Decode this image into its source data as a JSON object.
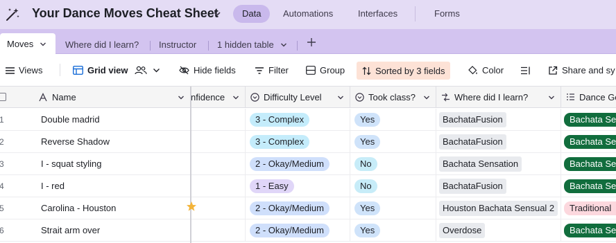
{
  "header": {
    "title": "Your Dance Moves Cheat Sheet",
    "nav": [
      "Data",
      "Automations",
      "Interfaces",
      "Forms"
    ]
  },
  "tables": {
    "active": "Moves",
    "others": [
      "Where did I learn?",
      "Instructor",
      "1 hidden table"
    ]
  },
  "toolbar": {
    "views": "Views",
    "grid_view": "Grid view",
    "hide_fields": "Hide fields",
    "filter": "Filter",
    "group": "Group",
    "sorted": "Sorted by 3 fields",
    "color": "Color",
    "share": "Share and sy"
  },
  "columns": [
    "Name",
    "nfidence",
    "Difficulty Level",
    "Took class?",
    "Where did I learn?",
    "Dance Ge"
  ],
  "rows": [
    {
      "num": "1",
      "name": "Double madrid",
      "difficulty": "3 - Complex",
      "took": "Yes",
      "where": "BachataFusion",
      "genre": "Bachata Se"
    },
    {
      "num": "2",
      "name": "Reverse Shadow",
      "difficulty": "3 - Complex",
      "took": "Yes",
      "where": "BachataFusion",
      "genre": "Bachata Se"
    },
    {
      "num": "3",
      "name": "I - squat styling",
      "difficulty": "2 - Okay/Medium",
      "took": "No",
      "where": "Bachata Sensation",
      "genre": "Bachata Se"
    },
    {
      "num": "4",
      "name": "I - red",
      "difficulty": "1 - Easy",
      "took": "No",
      "where": "BachataFusion",
      "genre": "Bachata Se"
    },
    {
      "num": "5",
      "name": "Carolina - Houston",
      "difficulty": "2 - Okay/Medium",
      "took": "Yes",
      "where": "Houston Bachata Sensual 2",
      "genre": "Traditional"
    },
    {
      "num": "6",
      "name": "Strait arm over",
      "difficulty": "2 - Okay/Medium",
      "took": "Yes",
      "where": "Overdose",
      "genre": "Bachata Se"
    }
  ],
  "colors": {
    "header_bg": "#e4dcf5",
    "tabs_bg": "#d3c4f0",
    "complex": "#c4ecfb",
    "medium": "#cfdffb",
    "easy": "#e0d6f8",
    "yes": "#cfe3fa",
    "no": "#c7ecf8",
    "location": "#e8eaee",
    "genre_bachata": "#116d3d",
    "genre_traditional": "#fcd8de",
    "sorted_bg": "#fde2d6"
  },
  "icons": [
    "magic-wand-icon",
    "chevron-down-icon",
    "plus-icon",
    "hamburger-icon",
    "grid-icon",
    "people-icon",
    "eye-slash-icon",
    "filter-icon",
    "group-icon",
    "sort-icon",
    "paint-bucket-icon",
    "row-height-icon",
    "share-icon",
    "text-field-icon",
    "select-field-icon",
    "link-field-icon",
    "star-icon"
  ]
}
